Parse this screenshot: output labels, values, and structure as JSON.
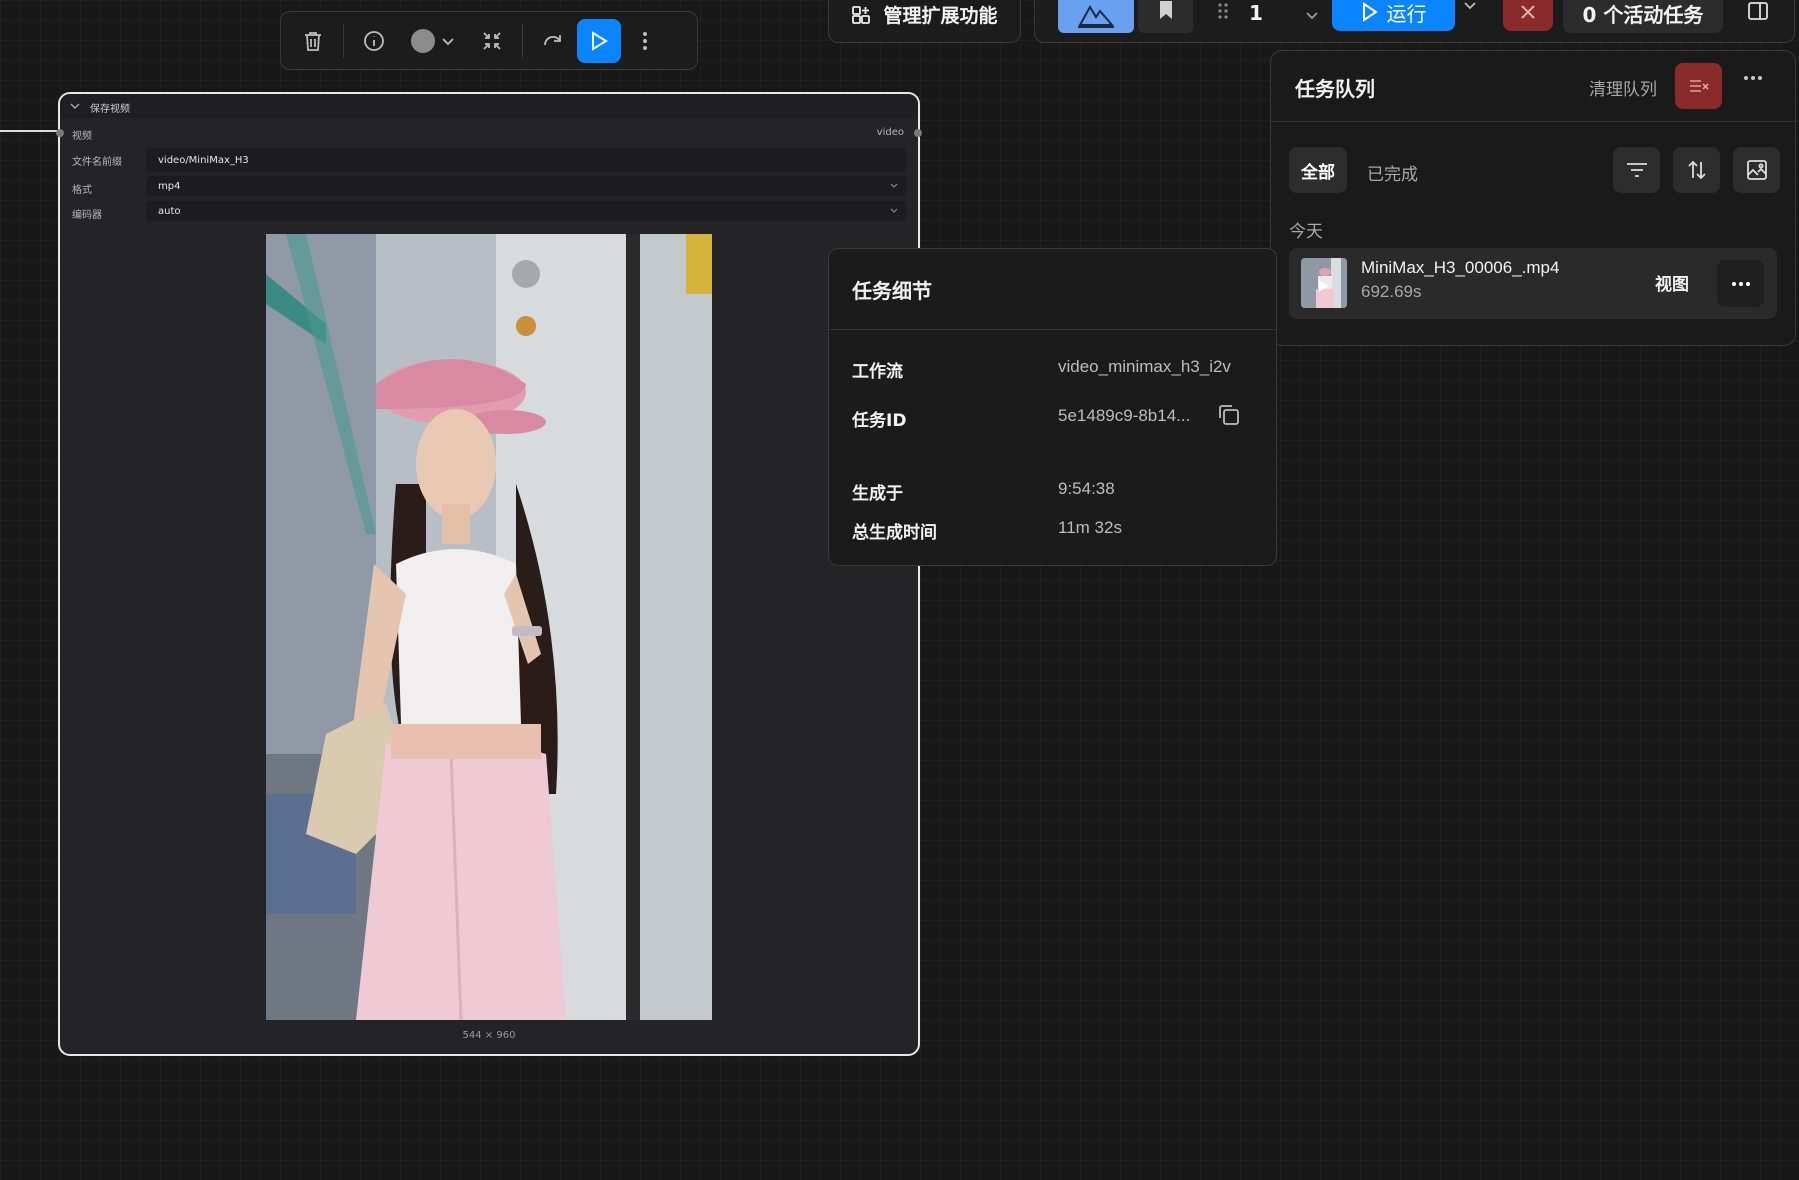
{
  "toolbar": {
    "delete_icon": "trash-icon",
    "info_icon": "info-icon",
    "color_icon": "color-dot-icon",
    "collapse_icon": "collapse-icon",
    "bypass_icon": "redo-icon",
    "run_icon": "play-icon",
    "more_icon": "more-vertical-icon"
  },
  "topbar": {
    "manage_extensions": "管理扩展功能",
    "batch_count": "1",
    "run_label": "运行",
    "active_jobs": "0 个活动任务"
  },
  "queue": {
    "title": "任务队列",
    "clear_label": "清理队列",
    "tab_all": "全部",
    "tab_completed": "已完成",
    "section_today": "今天",
    "jobs": [
      {
        "name": "MiniMax_H3_00006_.mp4",
        "duration": "692.69s",
        "view_label": "视图"
      }
    ]
  },
  "task_details": {
    "title": "任务细节",
    "rows": [
      {
        "label": "工作流",
        "value": "video_minimax_h3_i2v"
      },
      {
        "label": "任务ID",
        "value": "5e1489c9-8b14..."
      },
      {
        "label": "生成于",
        "value": "9:54:38"
      },
      {
        "label": "总生成时间",
        "value": "11m 32s"
      }
    ]
  },
  "node": {
    "title": "保存视频",
    "input_label": "视频",
    "output_label": "video",
    "widgets": [
      {
        "label": "文件名前缀",
        "value": "video/MiniMax_H3"
      },
      {
        "label": "格式",
        "value": "mp4"
      },
      {
        "label": "编码器",
        "value": "auto"
      }
    ],
    "preview_dims": "544 × 960"
  },
  "colors": {
    "accent": "#0b84ff",
    "danger": "#8a2a2a",
    "brand": "#6aa0f0"
  }
}
